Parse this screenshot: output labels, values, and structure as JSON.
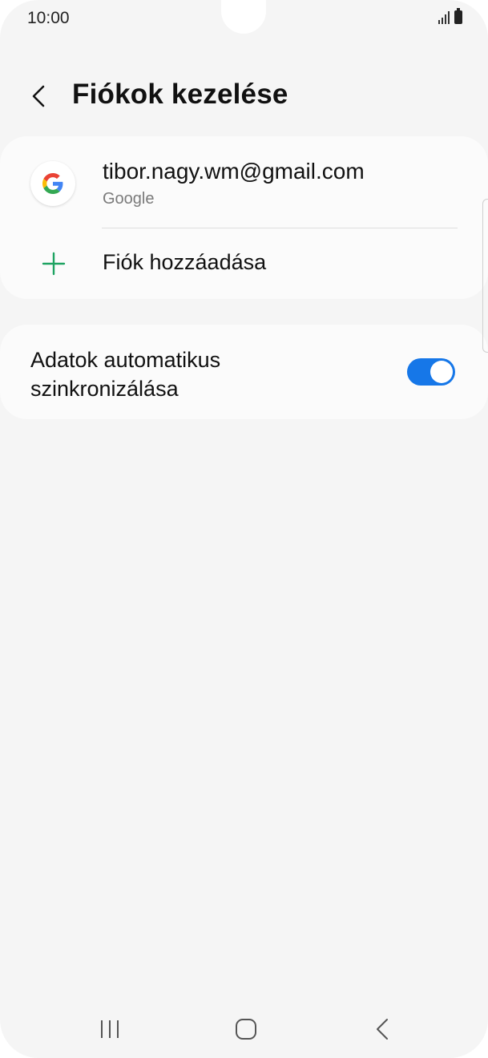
{
  "status_bar": {
    "time": "10:00",
    "icons": [
      "signal-icon",
      "battery-icon"
    ]
  },
  "header": {
    "back_icon": "chevron-left-icon",
    "title": "Fiókok kezelése"
  },
  "accounts": {
    "items": [
      {
        "email": "tibor.nagy.wm@gmail.com",
        "provider": "Google",
        "icon": "google-icon"
      }
    ],
    "add_label": "Fiók hozzáadása",
    "add_icon": "plus-icon"
  },
  "sync": {
    "label": "Adatok automatikus szinkronizálása",
    "enabled": true
  },
  "nav_bar": {
    "icons": [
      "recents-icon",
      "home-icon",
      "back-icon"
    ]
  },
  "colors": {
    "background": "#f5f5f5",
    "card": "#fbfbfb",
    "accent_toggle": "#1677e8",
    "plus_green": "#1ea362",
    "text_primary": "#111111",
    "text_secondary": "#7a7a7a"
  }
}
